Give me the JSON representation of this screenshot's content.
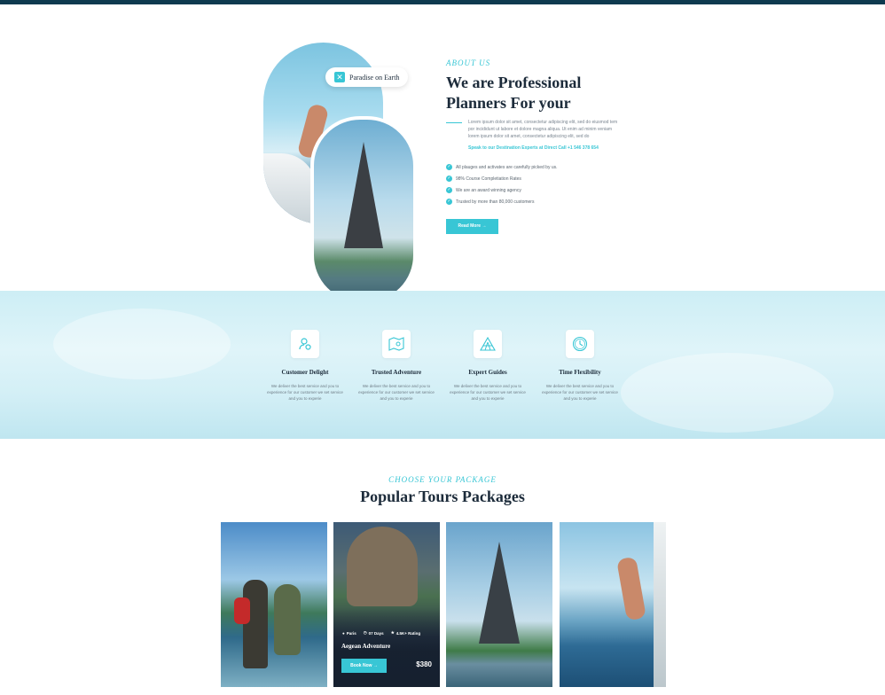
{
  "colors": {
    "accent": "#38c6d5",
    "dark_text": "#1c2b3a",
    "top_bar": "#0e3a4f"
  },
  "about": {
    "badge": "Paradise on Earth",
    "eyebrow": "ABOUT US",
    "title_line1": "We are Professional",
    "title_line2": "Planners For your",
    "description": "Lorem ipsum dolor sit amet, consectetur adipiscing elit, sed do eiusmod tem por incididunt ut labore et dolore magna aliqua. Ut enim ad minim veniam lorem ipsum dolor sit amet, consectetur adipiscing elit, sed do",
    "call_text": "Speak to our Destination Experts at Direct Call +1 546 378 654",
    "checklist": [
      "All plauges and activates are carefully picked by us.",
      "98% Course Completiation Rates",
      "We are an award winning agency",
      "Trusted by more than 80,000 customers"
    ],
    "button_label": "Read More →"
  },
  "features": [
    {
      "icon": "user-check-icon",
      "title": "Customer Delight",
      "desc": "We deliver the best service and you to experience for our customer we set service and you to experie"
    },
    {
      "icon": "map-icon",
      "title": "Trusted Adventure",
      "desc": "We deliver the best service and you to experience for our customer we set service and you to experie"
    },
    {
      "icon": "tent-icon",
      "title": "Expert Guides",
      "desc": "We deliver the best service and you to experience for our customer we set service and you to experie"
    },
    {
      "icon": "clock-icon",
      "title": "Time Flexibility",
      "desc": "We deliver the best service and you to experience for our customer we set service and you to experie"
    }
  ],
  "tours": {
    "eyebrow": "CHOOSE YOUR PACKAGE",
    "title": "Popular Tours Packages",
    "featured": {
      "location": "Paris",
      "duration": "07 Days",
      "rating": "4.5K+ Rating",
      "name": "Aegean Adventure",
      "button_label": "Book Now →",
      "price": "$380"
    }
  }
}
